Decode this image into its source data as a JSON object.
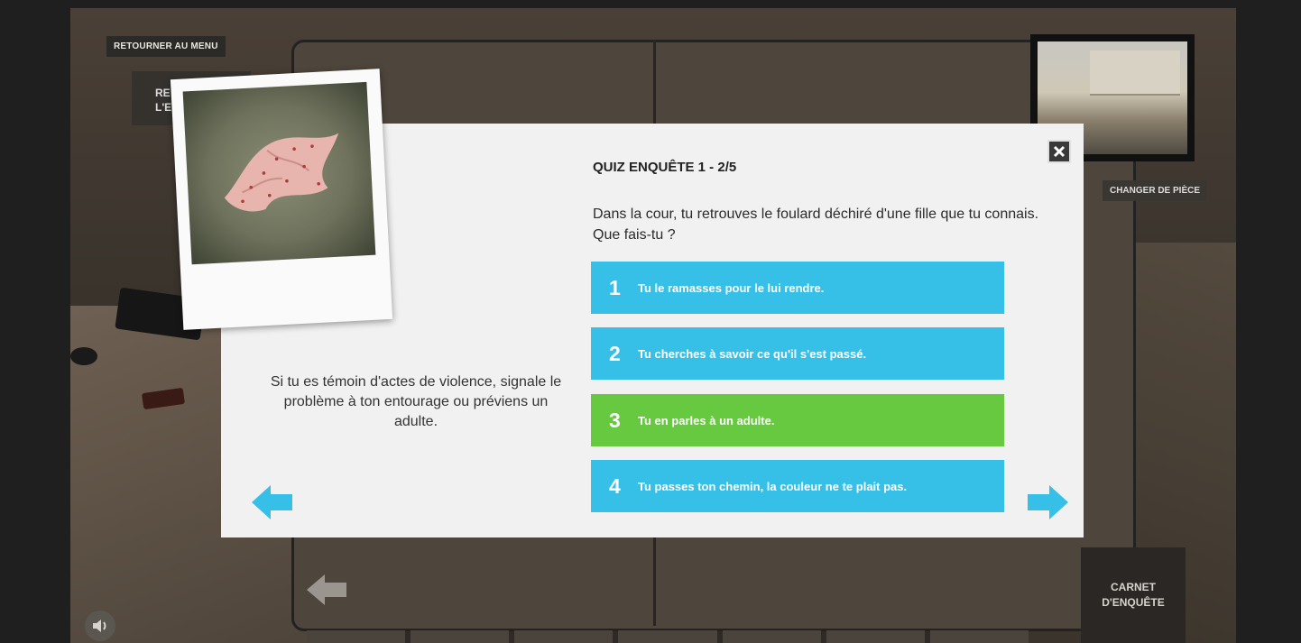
{
  "topbar": {
    "menu_label": "RETOURNER AU MENU",
    "secondary_label": "RE\nL'E"
  },
  "room": {
    "change_label": "CHANGER DE PIÈCE",
    "carnet_label": "CARNET\nD'ENQUÊTE"
  },
  "quiz": {
    "title": "QUIZ ENQUÊTE 1 - 2/5",
    "question": "Dans la cour, tu retrouves le foulard déchiré d'une fille que tu connais. Que fais-tu ?",
    "tip": "Si tu es témoin d'actes de violence, signale le problème à ton entourage ou préviens un adulte.",
    "answers": [
      {
        "num": "1",
        "text": "Tu le ramasses pour le lui rendre.",
        "state": "default"
      },
      {
        "num": "2",
        "text": "Tu cherches à savoir ce qu'il s'est passé.",
        "state": "default"
      },
      {
        "num": "3",
        "text": "Tu en parles à un adulte.",
        "state": "correct"
      },
      {
        "num": "4",
        "text": "Tu passes ton chemin, la couleur ne te plait pas.",
        "state": "default"
      }
    ]
  },
  "icons": {
    "close": "close-icon",
    "prev": "arrow-left-icon",
    "next": "arrow-right-icon",
    "back": "arrow-left-icon",
    "sound": "speaker-icon"
  },
  "colors": {
    "answer_default": "#36c0e8",
    "answer_correct": "#66c93f",
    "arrow": "#36c0e8"
  }
}
